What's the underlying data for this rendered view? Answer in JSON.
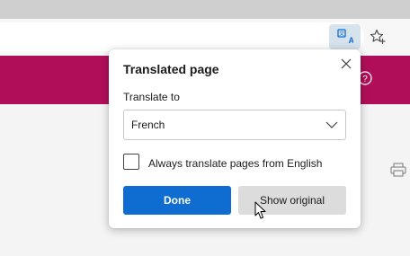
{
  "toolbar": {
    "translate_icon": "translate-icon",
    "favorite_icon": "star-add-icon"
  },
  "page": {
    "header_color": "#b10e5a",
    "help_icon": "question-circle-icon",
    "print_icon": "printer-icon"
  },
  "popup": {
    "title": "Translated page",
    "translate_to_label": "Translate to",
    "selected_language": "French",
    "always_translate_label": "Always translate pages from English",
    "always_translate_checked": false,
    "done_label": "Done",
    "show_original_label": "Show original",
    "accent_color": "#0f6cd1"
  }
}
